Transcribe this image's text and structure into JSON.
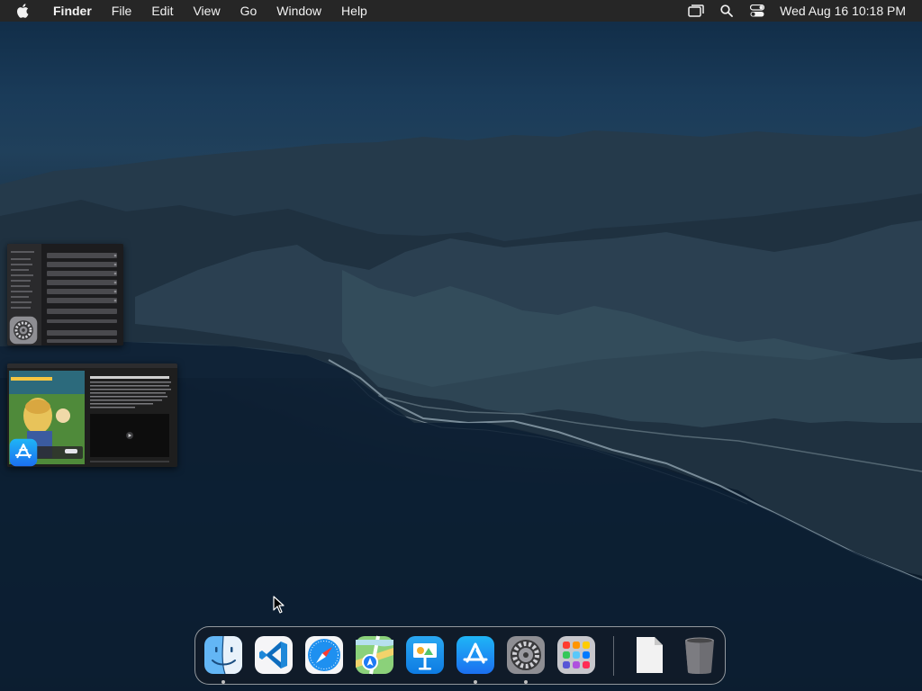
{
  "menubar": {
    "apple_icon": "apple-logo-icon",
    "app_name": "Finder",
    "menus": [
      "File",
      "Edit",
      "View",
      "Go",
      "Window",
      "Help"
    ],
    "status_icons": [
      "screen-mirroring-icon",
      "spotlight-search-icon",
      "control-center-icon"
    ],
    "clock": "Wed Aug 16  10:18 PM"
  },
  "desktop": {
    "window_thumbnails": [
      {
        "app": "System Preferences",
        "icon": "settings-gear-icon"
      },
      {
        "app": "App Store",
        "icon": "app-store-icon"
      }
    ]
  },
  "dock": {
    "apps": [
      {
        "name": "Finder",
        "icon": "finder-icon",
        "running": true
      },
      {
        "name": "Visual Studio Code",
        "icon": "vscode-icon",
        "running": false
      },
      {
        "name": "Safari",
        "icon": "safari-compass-icon",
        "running": false
      },
      {
        "name": "Maps",
        "icon": "maps-icon",
        "running": false
      },
      {
        "name": "Keynote",
        "icon": "keynote-icon",
        "running": false
      },
      {
        "name": "App Store",
        "icon": "app-store-icon",
        "running": true
      },
      {
        "name": "System Preferences",
        "icon": "settings-gear-icon",
        "running": true
      },
      {
        "name": "Launchpad",
        "icon": "launchpad-grid-icon",
        "running": false
      }
    ],
    "stack_items": [
      {
        "name": "Document",
        "icon": "document-icon"
      },
      {
        "name": "Trash",
        "icon": "trash-icon"
      }
    ]
  },
  "colors": {
    "menubar_bg": "#262626",
    "menubar_text": "#f2f2f2",
    "running_dot": "#bfbfbf",
    "wallpaper_dark": "#0c1d2f"
  }
}
